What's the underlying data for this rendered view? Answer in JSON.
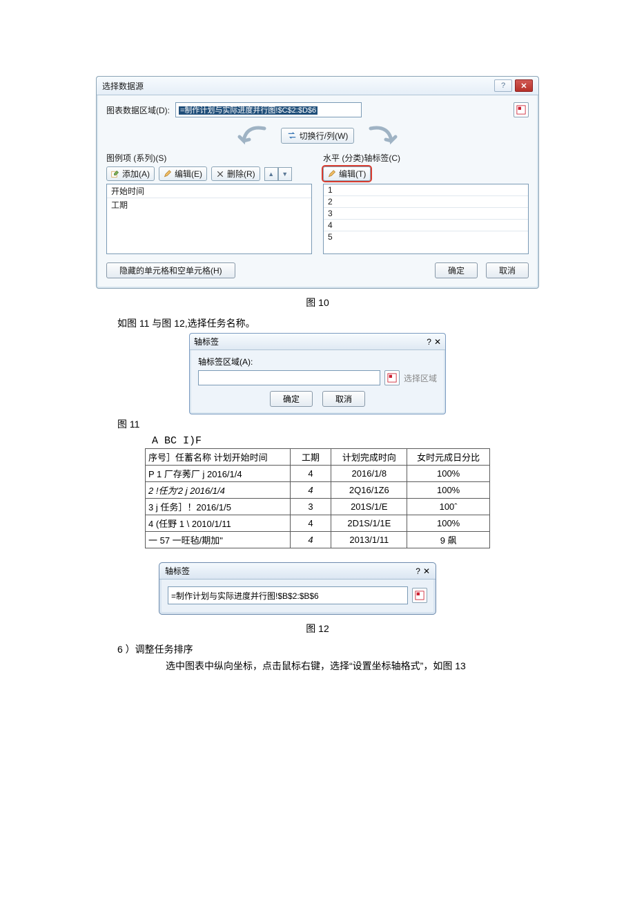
{
  "fig10": {
    "title": "选择数据源",
    "range_label": "图表数据区域(D):",
    "range_value": "=制作计划与实际进度并行图!$C$2:$D$6",
    "switch_btn": "切换行/列(W)",
    "left_col_title": "图例项 (系列)(S)",
    "right_col_title": "水平 (分类)轴标签(C)",
    "btn_add": "添加(A)",
    "btn_edit_left": "编辑(E)",
    "btn_delete": "删除(R)",
    "btn_edit_right": "编辑(T)",
    "series": [
      "开始时间",
      "工期"
    ],
    "axis_labels": [
      "1",
      "2",
      "3",
      "4",
      "5"
    ],
    "hidden_btn": "隐藏的单元格和空单元格(H)",
    "ok": "确定",
    "cancel": "取消",
    "caption": "图 10"
  },
  "paragraph_11_12": "如图 11 与图 12,选择任务名称。",
  "fig11": {
    "title": "轴标签",
    "label": "轴标签区域(A):",
    "hint": "选择区域",
    "ok": "确定",
    "cancel": "取消",
    "caption_side": "图 11"
  },
  "fig12": {
    "formula": "A  BC  I)F",
    "headers": [
      "序号］任蓄名称 计划开始时间",
      "工期",
      "计划完成时向",
      "女时元成日分比"
    ],
    "rows": [
      [
        "P 1 厂存莠厂 j 2016/1/4",
        "4",
        "2016/1/8",
        "100%"
      ],
      [
        "2 !任为'2 j 2016/1/4",
        "4",
        "2Q16/1Z6",
        "100%"
      ],
      [
        "3 j 任务］！2016/1/5",
        "3",
        "201S/1/E",
        "100ˆ"
      ],
      [
        "4 (任野 1 \\ 2010/1/11",
        "4",
        "2D1S/1/1E",
        "100%"
      ],
      [
        "一 57 一旺毡/期加\"",
        "4",
        "2013/1/11",
        "9 飙"
      ]
    ],
    "dlg_title": "轴标签",
    "dlg_value": "=制作计划与实际进度并行图!$B$2:$B$6",
    "caption": "图 12"
  },
  "step6": {
    "title": "6 ）调整任务排序",
    "body": "选中图表中纵向坐标，点击鼠标右键，选择“设置坐标轴格式”，如图 13"
  }
}
